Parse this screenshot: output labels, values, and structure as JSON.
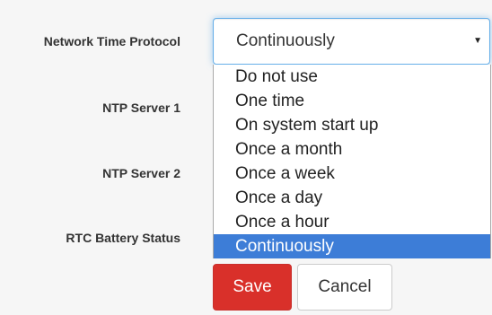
{
  "form": {
    "labels": {
      "ntp": "Network Time Protocol",
      "server1": "NTP Server 1",
      "server2": "NTP Server 2",
      "rtc": "RTC Battery Status"
    },
    "ntp_select": {
      "value": "Continuously",
      "arrow_icon": "caret-down-icon",
      "options": [
        "Do not use",
        "One time",
        "On system start up",
        "Once a month",
        "Once a week",
        "Once a day",
        "Once a hour",
        "Continuously"
      ],
      "highlighted_option": "Continuously"
    }
  },
  "buttons": {
    "save": "Save",
    "cancel": "Cancel"
  },
  "colors": {
    "save_bg": "#d9302a",
    "highlight_bg": "#3d7dd7",
    "focus_border": "#66afe9"
  }
}
